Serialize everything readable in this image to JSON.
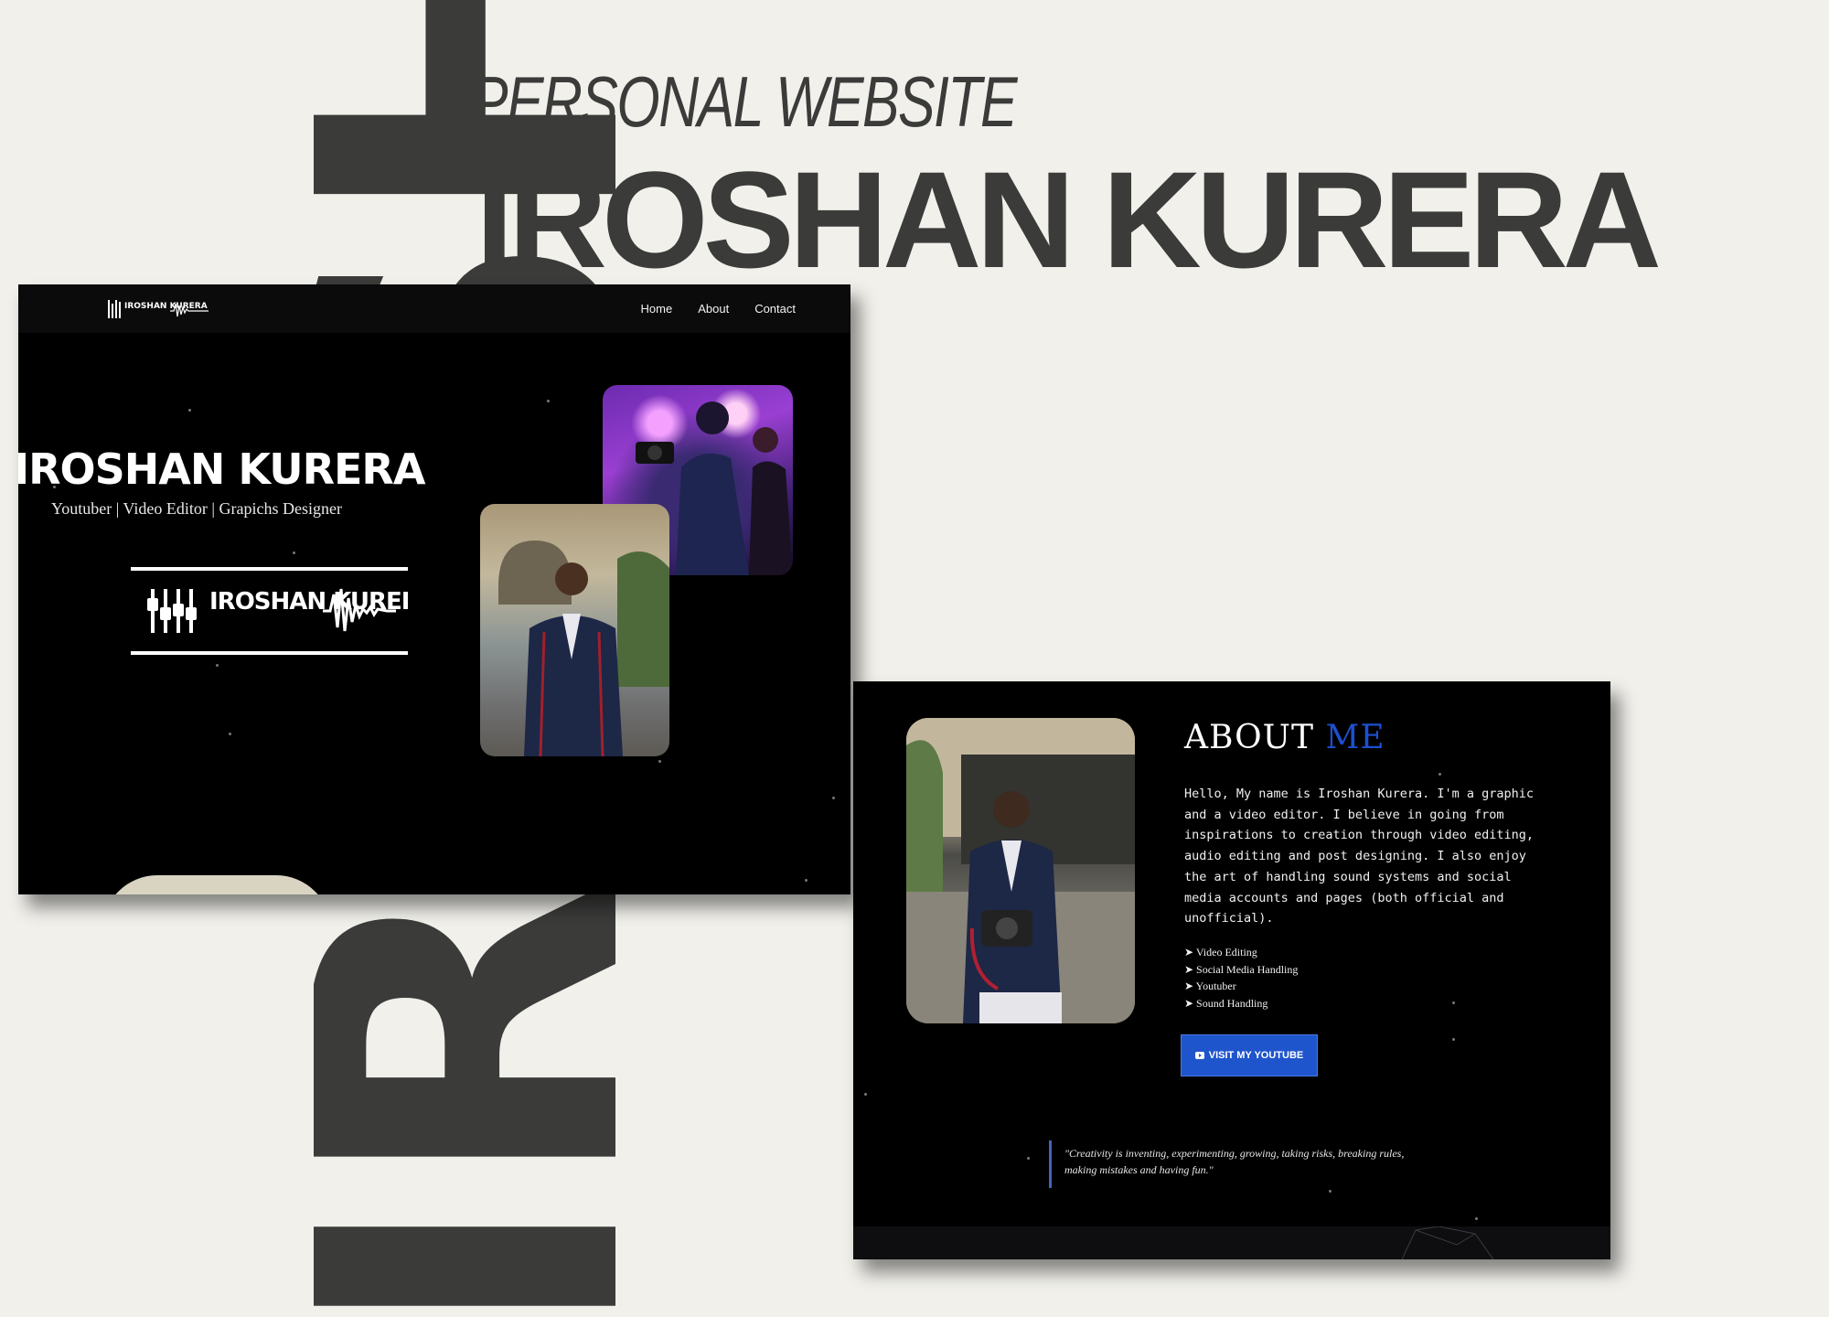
{
  "background_word": "IROSHAN",
  "presentation": {
    "eyebrow": "PERSONAL WEBSITE",
    "title": "IROSHAN KURERA"
  },
  "home": {
    "nav": {
      "logo": "IROSHAN KURERA",
      "links": [
        "Home",
        "About",
        "Contact"
      ]
    },
    "hero": {
      "title": "IROSHAN KURERA",
      "subtitle": "Youtuber | Video Editor | Grapichs Designer",
      "logo": "IROSHAN KURERA"
    }
  },
  "about": {
    "title": "ABOUT",
    "title_accent": "ME",
    "text": "Hello, My name is Iroshan Kurera. I'm a graphic and a video editor. I believe in going from inspirations to creation through video editing, audio editing and post designing. I also enjoy the art of handling sound systems and social media accounts and pages (both official and unofficial).",
    "skills": [
      "➤ Video Editing",
      "➤ Social Media Handling",
      "➤ Youtuber",
      "➤ Sound Handling"
    ],
    "button": "VISIT MY YOUTUBE",
    "quote": "\"Creativity is inventing, experimenting, growing, taking risks, breaking rules, making mistakes and having fun.\""
  },
  "colors": {
    "background": "#f1f0eb",
    "text_dark": "#3b3b3a",
    "accent_blue": "#1d4fd0",
    "button_blue": "#1f55cc",
    "panel": "#000000"
  }
}
